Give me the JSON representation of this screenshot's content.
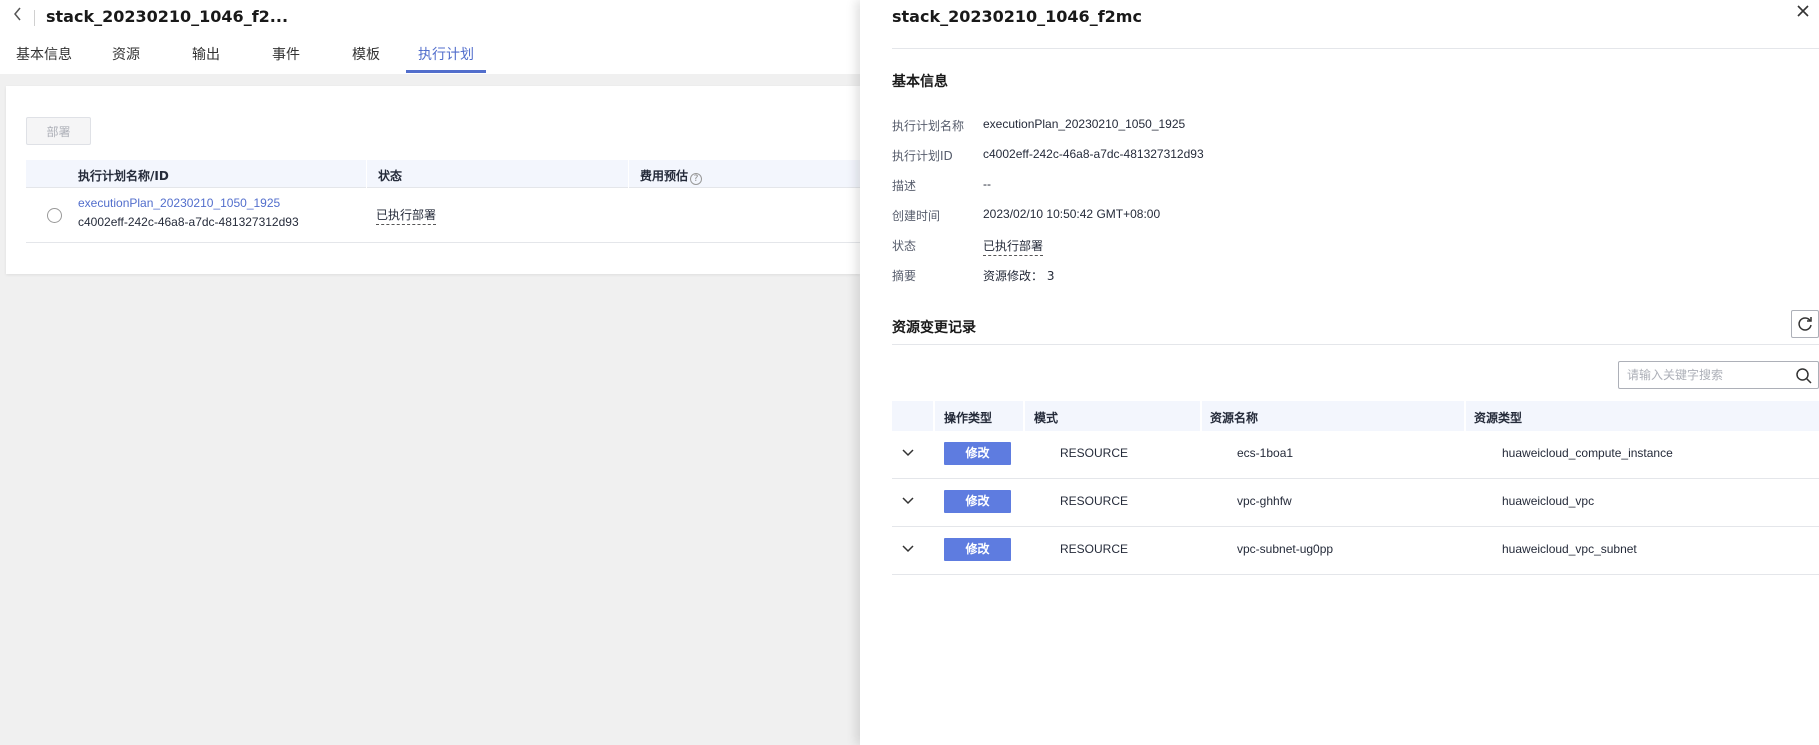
{
  "page": {
    "stack_title": "stack_20230210_1046_f2...",
    "tabs": [
      {
        "label": "基本信息"
      },
      {
        "label": "资源"
      },
      {
        "label": "输出"
      },
      {
        "label": "事件"
      },
      {
        "label": "模板"
      },
      {
        "label": "执行计划",
        "active": true
      }
    ],
    "deploy_label": "部署",
    "plan_table": {
      "headers": [
        "执行计划名称/ID",
        "状态",
        "费用预估"
      ],
      "rows": [
        {
          "name": "executionPlan_20230210_1050_1925",
          "id": "c4002eff-242c-46a8-a7dc-481327312d93",
          "status": "已执行部署"
        }
      ]
    }
  },
  "drawer": {
    "title": "stack_20230210_1046_f2mc",
    "basic_section_title": "基本信息",
    "fields": [
      {
        "label": "执行计划名称",
        "value": "executionPlan_20230210_1050_1925"
      },
      {
        "label": "执行计划ID",
        "value": "c4002eff-242c-46a8-a7dc-481327312d93"
      },
      {
        "label": "描述",
        "value": "--"
      },
      {
        "label": "创建时间",
        "value": "2023/02/10 10:50:42 GMT+08:00"
      },
      {
        "label": "状态",
        "value": "已执行部署"
      },
      {
        "label": "摘要",
        "value": "资源修改： 3"
      }
    ],
    "records_section_title": "资源变更记录",
    "search_placeholder": "请输入关键字搜索",
    "records_headers": [
      "操作类型",
      "模式",
      "资源名称",
      "资源类型"
    ],
    "records": [
      {
        "op": "修改",
        "mode": "RESOURCE",
        "name": "ecs-1boa1",
        "type": "huaweicloud_compute_instance"
      },
      {
        "op": "修改",
        "mode": "RESOURCE",
        "name": "vpc-ghhfw",
        "type": "huaweicloud_vpc"
      },
      {
        "op": "修改",
        "mode": "RESOURCE",
        "name": "vpc-subnet-ug0pp",
        "type": "huaweicloud_vpc_subnet"
      }
    ]
  },
  "colors": {
    "accent": "#526ecc",
    "badge": "#5e7ce0",
    "table_header_bg": "#f3f6fd"
  }
}
